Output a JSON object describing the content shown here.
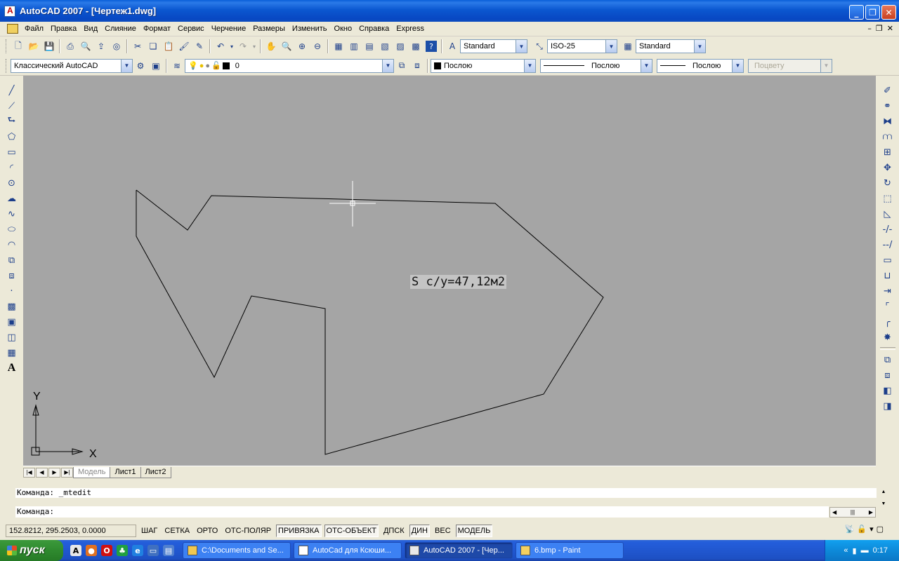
{
  "window": {
    "title": "AutoCAD 2007 - [Чертеж1.dwg]"
  },
  "menu": {
    "items": [
      "Файл",
      "Правка",
      "Вид",
      "Слияние",
      "Формат",
      "Сервис",
      "Черчение",
      "Размеры",
      "Изменить",
      "Окно",
      "Справка",
      "Express"
    ]
  },
  "toolbar": {
    "text_style": "Standard",
    "dim_style": "ISO-25",
    "table_style": "Standard",
    "workspace": "Классический AutoCAD",
    "layer": "0",
    "color": "Послою",
    "linetype": "Послою",
    "lineweight": "Послою",
    "plot_style": "Поцвету"
  },
  "drawing": {
    "area_label": "S с/у=47,12м2",
    "ucs_x": "X",
    "ucs_y": "Y",
    "colors": {
      "background": "#a5a5a5",
      "linework": "#000000"
    },
    "polyline_note": "closed outline drawn by script"
  },
  "tabs": [
    "Модель",
    "Лист1",
    "Лист2"
  ],
  "command": {
    "history": "Команда:  _mtedit",
    "prompt": "Команда:"
  },
  "status": {
    "coords": "152.8212, 295.2503, 0.0000",
    "toggles": [
      {
        "label": "ШАГ",
        "on": false
      },
      {
        "label": "СЕТКА",
        "on": false
      },
      {
        "label": "ОРТО",
        "on": false
      },
      {
        "label": "ОТС-ПОЛЯР",
        "on": false
      },
      {
        "label": "ПРИВЯЗКА",
        "on": true
      },
      {
        "label": "ОТС-ОБЪЕКТ",
        "on": true
      },
      {
        "label": "ДПСК",
        "on": false
      },
      {
        "label": "ДИН",
        "on": true
      },
      {
        "label": "ВЕС",
        "on": false
      },
      {
        "label": "МОДЕЛЬ",
        "on": true
      }
    ]
  },
  "taskbar": {
    "start_label": "пуск",
    "tasks": [
      {
        "label": "C:\\Documents and Se...",
        "active": false
      },
      {
        "label": "AutoCad для Ксюши...",
        "active": false
      },
      {
        "label": "AutoCAD 2007 - [Чер...",
        "active": true
      },
      {
        "label": "6.bmp - Paint",
        "active": false
      }
    ],
    "clock": "0:17"
  }
}
